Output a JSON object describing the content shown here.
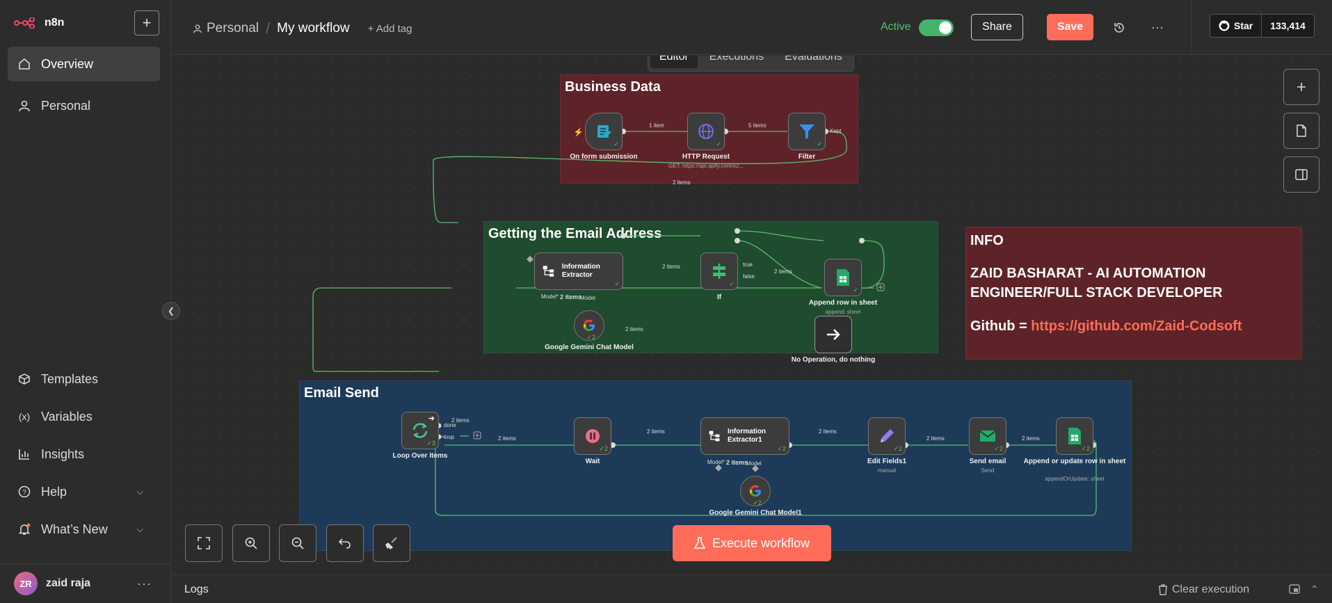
{
  "app": {
    "name": "n8n"
  },
  "sidebar": {
    "items": [
      {
        "label": "Overview",
        "icon": "home-icon"
      },
      {
        "label": "Personal",
        "icon": "user-icon"
      }
    ],
    "bottom_items": [
      {
        "label": "Templates",
        "icon": "box-icon"
      },
      {
        "label": "Variables",
        "icon": "variable-icon"
      },
      {
        "label": "Insights",
        "icon": "chart-icon"
      },
      {
        "label": "Help",
        "icon": "help-icon"
      },
      {
        "label": "What’s New",
        "icon": "bell-icon"
      }
    ],
    "user": {
      "initials": "ZR",
      "name": "zaid raja"
    }
  },
  "header": {
    "project": "Personal",
    "workflow": "My workflow",
    "add_tag": "+ Add tag",
    "active_label": "Active",
    "share": "Share",
    "save": "Save",
    "github_star": "Star",
    "github_count": "133,414"
  },
  "tabs": [
    "Editor",
    "Executions",
    "Evaluations"
  ],
  "groups": {
    "business": "Business Data",
    "email": "Getting the Email Address",
    "send": "Email Send"
  },
  "info": {
    "title": "INFO",
    "line1": "ZAID BASHARAT - AI AUTOMATION",
    "line2": "ENGINEER/FULL STACK DEVELOPER",
    "github_prefix": "Github = ",
    "github_url": "https://github.com/Zaid-Codsoft"
  },
  "nodes": {
    "form": "On form submission",
    "http": "HTTP Request",
    "http_sub": "GET: https://api.apify.com/v2...",
    "filter": "Filter",
    "info_ex": "Information Extractor",
    "if": "If",
    "append_row": "Append row in sheet",
    "append_row_sub": "append: sheet",
    "noop": "No Operation, do nothing",
    "gemini": "Google Gemini Chat Model",
    "loop": "Loop Over Items",
    "wait": "Wait",
    "info_ex1": "Information Extractor1",
    "edit": "Edit Fields1",
    "edit_sub": "manual",
    "send": "Send email",
    "send_sub": "Send",
    "append_upd": "Append or update row in sheet",
    "append_upd_sub": "appendOrUpdate: sheet",
    "gemini1": "Google Gemini Chat Model1"
  },
  "edges": {
    "e1": "1 item",
    "e2": "5 items",
    "kept": "Kept",
    "e3": "2 items",
    "e4": "2 items",
    "true": "true",
    "false": "false",
    "e5": "2 items",
    "e6": "2 items",
    "model_a": "Model*",
    "e7": "2 items",
    "model_b": "Model",
    "done": "done",
    "e8": "2 items",
    "loop": "loop",
    "e9": "2 items",
    "e10": "2 items",
    "e11": "2 items",
    "e12": "2 items",
    "e13": "2 items",
    "model_c": "Model*",
    "e14": "2 items",
    "model_d": "Model"
  },
  "execute": "Execute workflow",
  "logs": {
    "title": "Logs",
    "clear": "Clear execution"
  },
  "colors": {
    "accent": "#ff6d5a",
    "active": "#44b46b",
    "wire": "#5ebd6e"
  }
}
